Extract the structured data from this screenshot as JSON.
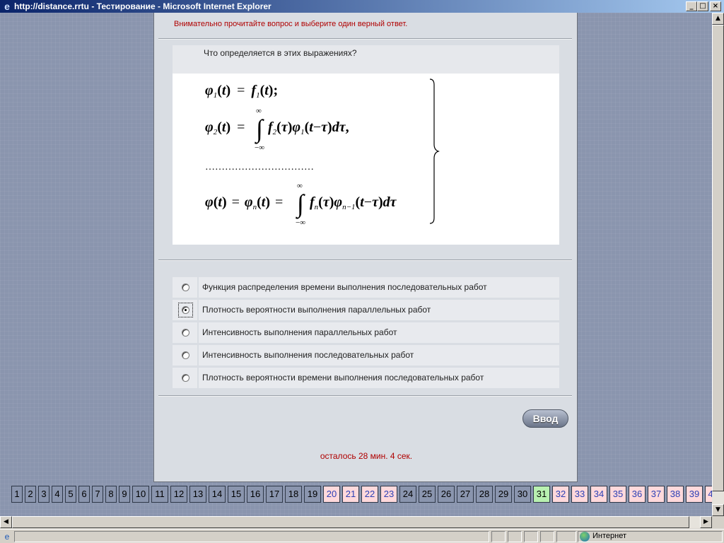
{
  "window": {
    "title": "http://distance.rrtu - Тестирование - Microsoft Internet Explorer",
    "min_glyph": "_",
    "max_glyph": "□",
    "close_glyph": "×",
    "app_icon": "e"
  },
  "page": {
    "instruction": "Внимательно прочитайте вопрос и выберите один верный ответ.",
    "question": "Что определяется в этих выражениях?",
    "formula": {
      "phi": "φ",
      "f": "f",
      "t": "t",
      "tau": "τ",
      "eq": "=",
      "minus": "−",
      "inf": "∞",
      "neg_inf": "−∞",
      "integral": "∫",
      "d": "d",
      "sub1": "1",
      "sub2": "2",
      "subn": "n",
      "subn1": "n−1",
      "semicolon": ";",
      "comma": ",",
      "lparen": "(",
      "rparen": ")",
      "dots": "……………………………"
    },
    "answers": [
      {
        "label": "Функция распределения времени выполнения последовательных работ",
        "selected": false
      },
      {
        "label": "Плотность вероятности выполнения параллельных работ",
        "selected": true
      },
      {
        "label": "Интенсивность выполнения параллельных работ",
        "selected": false
      },
      {
        "label": "Интенсивность выполнения последовательных работ",
        "selected": false
      },
      {
        "label": "Плотность вероятности времени выполнения последовательных работ",
        "selected": false
      }
    ],
    "submit_label": "Ввод",
    "timer": "осталось 28 мин. 4 сек.",
    "question_nav": [
      {
        "n": "1",
        "state": "unanswered"
      },
      {
        "n": "2",
        "state": "unanswered"
      },
      {
        "n": "3",
        "state": "unanswered"
      },
      {
        "n": "4",
        "state": "unanswered"
      },
      {
        "n": "5",
        "state": "unanswered"
      },
      {
        "n": "6",
        "state": "unanswered"
      },
      {
        "n": "7",
        "state": "unanswered"
      },
      {
        "n": "8",
        "state": "unanswered"
      },
      {
        "n": "9",
        "state": "unanswered"
      },
      {
        "n": "10",
        "state": "unanswered"
      },
      {
        "n": "11",
        "state": "unanswered"
      },
      {
        "n": "12",
        "state": "unanswered"
      },
      {
        "n": "13",
        "state": "unanswered"
      },
      {
        "n": "14",
        "state": "unanswered"
      },
      {
        "n": "15",
        "state": "unanswered"
      },
      {
        "n": "16",
        "state": "unanswered"
      },
      {
        "n": "17",
        "state": "unanswered"
      },
      {
        "n": "18",
        "state": "unanswered"
      },
      {
        "n": "19",
        "state": "unanswered"
      },
      {
        "n": "20",
        "state": "answered"
      },
      {
        "n": "21",
        "state": "answered"
      },
      {
        "n": "22",
        "state": "answered"
      },
      {
        "n": "23",
        "state": "answered"
      },
      {
        "n": "24",
        "state": "unanswered"
      },
      {
        "n": "25",
        "state": "unanswered"
      },
      {
        "n": "26",
        "state": "unanswered"
      },
      {
        "n": "27",
        "state": "unanswered"
      },
      {
        "n": "28",
        "state": "unanswered"
      },
      {
        "n": "29",
        "state": "unanswered"
      },
      {
        "n": "30",
        "state": "unanswered"
      },
      {
        "n": "31",
        "state": "current"
      },
      {
        "n": "32",
        "state": "answered"
      },
      {
        "n": "33",
        "state": "answered"
      },
      {
        "n": "34",
        "state": "answered"
      },
      {
        "n": "35",
        "state": "answered"
      },
      {
        "n": "36",
        "state": "answered"
      },
      {
        "n": "37",
        "state": "answered"
      },
      {
        "n": "38",
        "state": "answered"
      },
      {
        "n": "39",
        "state": "answered"
      },
      {
        "n": "4",
        "state": "answered"
      }
    ]
  },
  "scrollbars": {
    "up": "▲",
    "down": "▼",
    "left": "◀",
    "right": "▶"
  },
  "status": {
    "zone": "Интернет",
    "icon": "e"
  }
}
